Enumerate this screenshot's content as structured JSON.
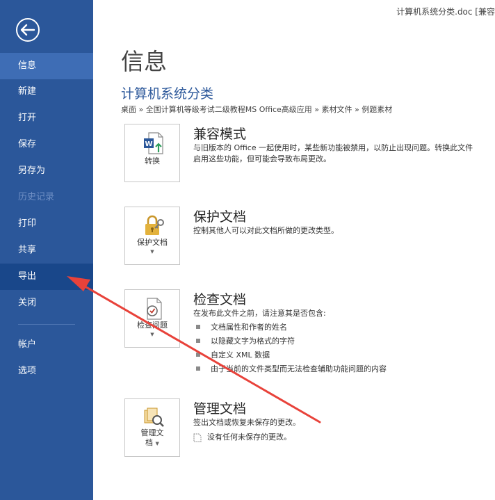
{
  "window": {
    "doc_title": "计算机系统分类.doc [兼容"
  },
  "sidebar": {
    "items": [
      {
        "label": "信息",
        "state": "active"
      },
      {
        "label": "新建",
        "state": "normal"
      },
      {
        "label": "打开",
        "state": "normal"
      },
      {
        "label": "保存",
        "state": "normal"
      },
      {
        "label": "另存为",
        "state": "normal"
      },
      {
        "label": "历史记录",
        "state": "disabled"
      },
      {
        "label": "打印",
        "state": "normal"
      },
      {
        "label": "共享",
        "state": "normal"
      },
      {
        "label": "导出",
        "state": "hover"
      },
      {
        "label": "关闭",
        "state": "normal"
      },
      {
        "label": "帐户",
        "state": "normal"
      },
      {
        "label": "选项",
        "state": "normal"
      }
    ]
  },
  "main": {
    "page_title": "信息",
    "doc_name": "计算机系统分类",
    "breadcrumb": "桌面 » 全国计算机等级考试二级教程MS Office高级应用 » 素材文件 » 例题素材",
    "sections": [
      {
        "title": "兼容模式",
        "tile_label": "转换",
        "desc_lines": [
          "与旧版本的 Office 一起使用时，某些新功能被禁用，以防止出现问题。转换此文件",
          "启用这些功能，但可能会导致布局更改。"
        ]
      },
      {
        "title": "保护文档",
        "tile_label": "保护文档",
        "desc_lines": [
          "控制其他人可以对此文档所做的更改类型。"
        ]
      },
      {
        "title": "检查文档",
        "tile_label": "检查问题",
        "desc_lines": [
          "在发布此文件之前，请注意其是否包含:"
        ],
        "bullets": [
          "文档属性和作者的姓名",
          "以隐藏文字为格式的字符",
          "自定义 XML 数据",
          "由于当前的文件类型而无法检查辅助功能问题的内容"
        ]
      },
      {
        "title": "管理文档",
        "tile_label_lines": [
          "管理文",
          "档"
        ],
        "desc_lines": [
          "签出文档或恢复未保存的更改。"
        ],
        "sub_item": "没有任何未保存的更改。"
      }
    ]
  },
  "colors": {
    "sidebar": "#2b579a",
    "accent": "#2b579a",
    "annotation_arrow": "#e8423a"
  }
}
